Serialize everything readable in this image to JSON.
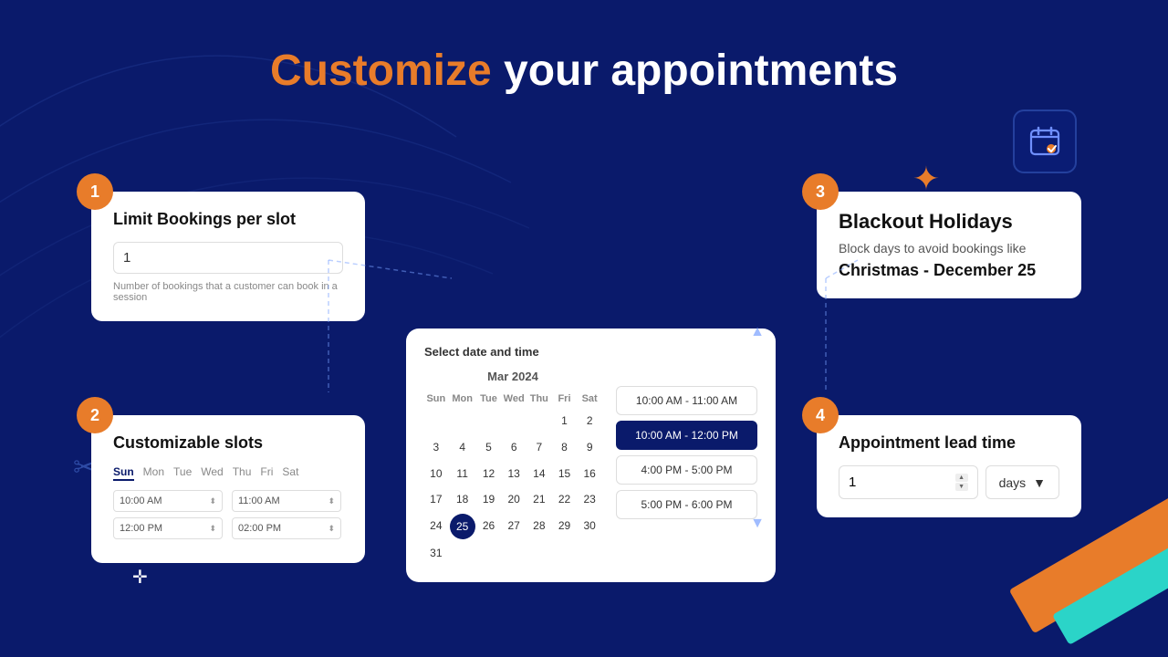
{
  "title": {
    "part1": "Customize",
    "part2": " your appointments"
  },
  "card1": {
    "step": "1",
    "title": "Limit Bookings per slot",
    "input_value": "1",
    "hint": "Number of bookings that a customer can book in a session"
  },
  "card2": {
    "step": "2",
    "title": "Customizable slots",
    "days": [
      "Sun",
      "Mon",
      "Tue",
      "Wed",
      "Thu",
      "Fri",
      "Sat"
    ],
    "active_day": "Sun",
    "row1": [
      "10:00 AM",
      "11:00 AM"
    ],
    "row2": [
      "12:00 PM",
      "02:00 PM"
    ]
  },
  "calendar": {
    "header": "Select date and time",
    "month": "Mar 2024",
    "day_headers": [
      "Sun",
      "Mon",
      "Tue",
      "Wed",
      "Thu",
      "Fri",
      "Sat"
    ],
    "selected_day": "25",
    "time_slots": [
      {
        "label": "10:00 AM - 11:00 AM",
        "selected": false
      },
      {
        "label": "10:00 AM - 12:00 PM",
        "selected": true
      },
      {
        "label": "4:00 PM - 5:00 PM",
        "selected": false
      },
      {
        "label": "5:00 PM - 6:00 PM",
        "selected": false
      }
    ]
  },
  "card3": {
    "step": "3",
    "title": "Blackout Holidays",
    "description": "Block days to avoid bookings like",
    "date": "Christmas - December 25"
  },
  "card4": {
    "step": "4",
    "title": "Appointment lead time",
    "number_value": "1",
    "unit_value": "days"
  },
  "icons": {
    "calendar": "📅",
    "scissors": "✂",
    "sparkle": "✦"
  }
}
